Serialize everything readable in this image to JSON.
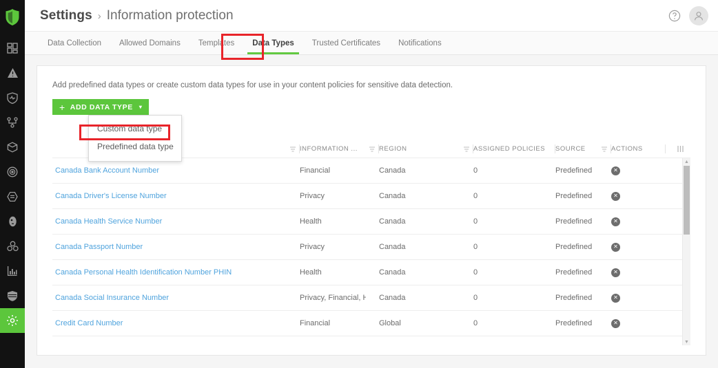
{
  "rail": {
    "logo_name": "company-logo",
    "items": [
      {
        "icon": "dashboard-icon",
        "active": false
      },
      {
        "icon": "alert-triangle-icon",
        "active": false
      },
      {
        "icon": "shield-pulse-icon",
        "active": false
      },
      {
        "icon": "network-topology-icon",
        "active": false
      },
      {
        "icon": "package-box-icon",
        "active": false
      },
      {
        "icon": "target-icon",
        "active": false
      },
      {
        "icon": "hexagon-document-icon",
        "active": false
      },
      {
        "icon": "face-id-icon",
        "active": false
      },
      {
        "icon": "molecule-cluster-icon",
        "active": false
      },
      {
        "icon": "bar-chart-icon",
        "active": false
      },
      {
        "icon": "shield-web-icon",
        "active": false
      },
      {
        "icon": "settings-gear-icon",
        "active": true
      }
    ]
  },
  "header": {
    "breadcrumb_root": "Settings",
    "breadcrumb_separator": "›",
    "breadcrumb_leaf": "Information protection",
    "help_icon": "help-circle-icon",
    "avatar_icon": "user-avatar-icon"
  },
  "tabs": [
    {
      "label": "Data Collection",
      "active": false
    },
    {
      "label": "Allowed Domains",
      "active": false
    },
    {
      "label": "Templates",
      "active": false
    },
    {
      "label": "Data Types",
      "active": true
    },
    {
      "label": "Trusted Certificates",
      "active": false
    },
    {
      "label": "Notifications",
      "active": false
    }
  ],
  "card": {
    "description": "Add predefined data types or create custom data types for use in your content policies for sensitive data detection.",
    "add_button": {
      "plus": "+",
      "label": "ADD DATA TYPE",
      "caret": "▾"
    },
    "dropdown": {
      "items": [
        {
          "label": "Custom data type",
          "highlighted": true
        },
        {
          "label": "Predefined data type",
          "highlighted": false
        }
      ]
    }
  },
  "table": {
    "columns": [
      {
        "key": "name",
        "label": "",
        "filter": false
      },
      {
        "key": "info",
        "label": "INFORMATION ...",
        "filter": true
      },
      {
        "key": "region",
        "label": "REGION",
        "filter": true
      },
      {
        "key": "policies",
        "label": "ASSIGNED POLICIES",
        "filter": true
      },
      {
        "key": "source",
        "label": "SOURCE",
        "filter": true
      },
      {
        "key": "actions",
        "label": "ACTIONS",
        "filter": false
      }
    ],
    "column_picker_icon": "column-chooser-icon",
    "filter_icon": "filter-icon",
    "delete_icon": "delete-circle-icon",
    "rows": [
      {
        "name": "Canada Bank Account Number",
        "info": "Financial",
        "region": "Canada",
        "policies": "0",
        "source": "Predefined"
      },
      {
        "name": "Canada Driver's License Number",
        "info": "Privacy",
        "region": "Canada",
        "policies": "0",
        "source": "Predefined"
      },
      {
        "name": "Canada Health Service Number",
        "info": "Health",
        "region": "Canada",
        "policies": "0",
        "source": "Predefined"
      },
      {
        "name": "Canada Passport Number",
        "info": "Privacy",
        "region": "Canada",
        "policies": "0",
        "source": "Predefined"
      },
      {
        "name": "Canada Personal Health Identification Number PHIN",
        "info": "Health",
        "region": "Canada",
        "policies": "0",
        "source": "Predefined"
      },
      {
        "name": "Canada Social Insurance Number",
        "info": "Privacy, Financial, Healt",
        "region": "Canada",
        "policies": "0",
        "source": "Predefined"
      },
      {
        "name": "Credit Card Number",
        "info": "Financial",
        "region": "Global",
        "policies": "0",
        "source": "Predefined"
      }
    ],
    "scrollbar": {
      "up_arrow": "▲",
      "down_arrow": "▼"
    }
  },
  "annotations": [
    {
      "name": "data-types-tab-highlight",
      "color": "#e8242a"
    },
    {
      "name": "custom-data-type-highlight",
      "color": "#e8242a"
    }
  ]
}
